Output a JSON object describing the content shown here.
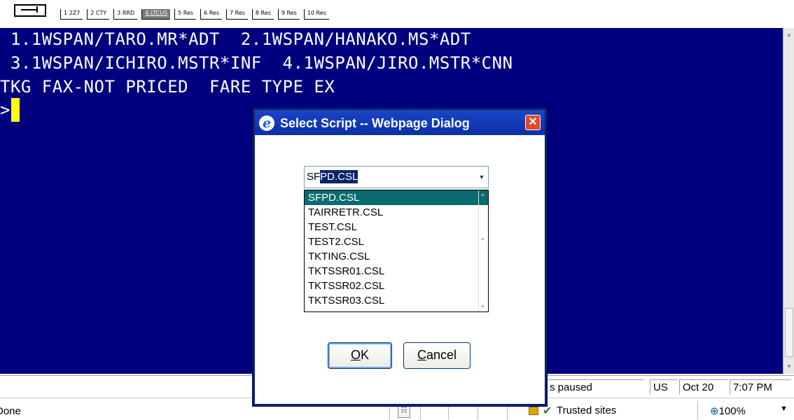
{
  "tabs": {
    "items": [
      {
        "label": "1 2Z7",
        "active": false
      },
      {
        "label": "2 CTY",
        "active": false
      },
      {
        "label": "3 RRD",
        "active": false
      },
      {
        "label": "4 LTCUS",
        "active": true
      },
      {
        "label": "5 Res",
        "active": false
      },
      {
        "label": "6 Res",
        "active": false
      },
      {
        "label": "7 Res",
        "active": false
      },
      {
        "label": "8 Res",
        "active": false
      },
      {
        "label": "9 Res",
        "active": false
      },
      {
        "label": "10 Res",
        "active": false
      }
    ]
  },
  "terminal": {
    "lines": [
      " 1.1WSPAN/TARO.MR*ADT  2.1WSPAN/HANAKO.MS*ADT",
      " 3.1WSPAN/ICHIRO.MSTR*INF  4.1WSPAN/JIRO.MSTR*CNN",
      "TKG FAX-NOT PRICED  FARE TYPE EX"
    ],
    "prompt": ">"
  },
  "statusbar": {
    "paused": "s paused",
    "locale": "US",
    "date": "Oct 20",
    "time": "7:07 PM"
  },
  "iebar": {
    "status": "Done",
    "zone": "Trusted sites",
    "zoom": "100%"
  },
  "dialog": {
    "title": "Select Script -- Webpage Dialog",
    "combo_typed": "SF",
    "combo_selected": "PD.CSL",
    "options": [
      "SFPD.CSL",
      "TAIRRETR.CSL",
      "TEST.CSL",
      "TEST2.CSL",
      "TKTING.CSL",
      "TKTSSR01.CSL",
      "TKTSSR02.CSL",
      "TKTSSR03.CSL"
    ],
    "selected_index": 0,
    "ok_mnemonic": "O",
    "ok_rest": "K",
    "cancel_mnemonic": "C",
    "cancel_rest": "ancel"
  },
  "icons": {
    "app_button": "keyboard-icon",
    "dialog_icon": "internet-explorer-icon",
    "close": "close-icon",
    "zone": "check-icon",
    "zoom": "zoom-icon"
  }
}
